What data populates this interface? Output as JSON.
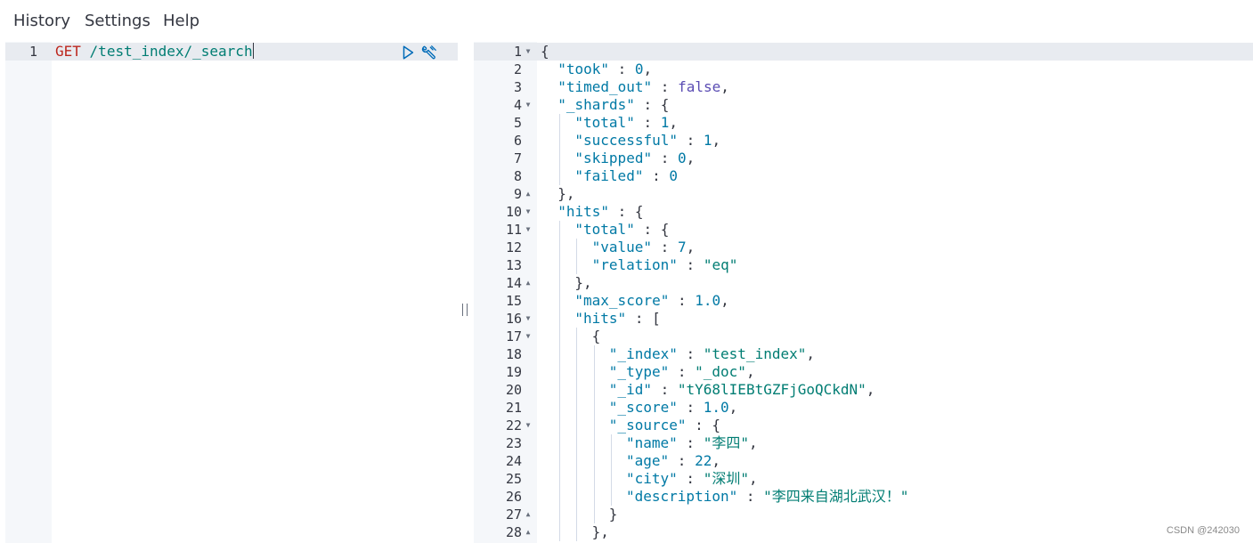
{
  "menu": {
    "history": "History",
    "settings": "Settings",
    "help": "Help"
  },
  "request": {
    "line_number": "1",
    "method": "GET",
    "path": "/test_index/_search"
  },
  "response": {
    "lines": [
      {
        "n": "1",
        "fold": "down",
        "indent": 0,
        "t": [
          [
            "p",
            "{"
          ]
        ]
      },
      {
        "n": "2",
        "indent": 1,
        "t": [
          [
            "k",
            "\"took\""
          ],
          [
            "p",
            " : "
          ],
          [
            "n",
            "0"
          ],
          [
            "p",
            ","
          ]
        ]
      },
      {
        "n": "3",
        "indent": 1,
        "t": [
          [
            "k",
            "\"timed_out\""
          ],
          [
            "p",
            " : "
          ],
          [
            "b",
            "false"
          ],
          [
            "p",
            ","
          ]
        ]
      },
      {
        "n": "4",
        "fold": "down",
        "indent": 1,
        "t": [
          [
            "k",
            "\"_shards\""
          ],
          [
            "p",
            " : {"
          ]
        ]
      },
      {
        "n": "5",
        "indent": 2,
        "t": [
          [
            "k",
            "\"total\""
          ],
          [
            "p",
            " : "
          ],
          [
            "n",
            "1"
          ],
          [
            "p",
            ","
          ]
        ]
      },
      {
        "n": "6",
        "indent": 2,
        "t": [
          [
            "k",
            "\"successful\""
          ],
          [
            "p",
            " : "
          ],
          [
            "n",
            "1"
          ],
          [
            "p",
            ","
          ]
        ]
      },
      {
        "n": "7",
        "indent": 2,
        "t": [
          [
            "k",
            "\"skipped\""
          ],
          [
            "p",
            " : "
          ],
          [
            "n",
            "0"
          ],
          [
            "p",
            ","
          ]
        ]
      },
      {
        "n": "8",
        "indent": 2,
        "t": [
          [
            "k",
            "\"failed\""
          ],
          [
            "p",
            " : "
          ],
          [
            "n",
            "0"
          ]
        ]
      },
      {
        "n": "9",
        "fold": "up",
        "indent": 1,
        "t": [
          [
            "p",
            "},"
          ]
        ]
      },
      {
        "n": "10",
        "fold": "down",
        "indent": 1,
        "t": [
          [
            "k",
            "\"hits\""
          ],
          [
            "p",
            " : {"
          ]
        ]
      },
      {
        "n": "11",
        "fold": "down",
        "indent": 2,
        "t": [
          [
            "k",
            "\"total\""
          ],
          [
            "p",
            " : {"
          ]
        ]
      },
      {
        "n": "12",
        "indent": 3,
        "t": [
          [
            "k",
            "\"value\""
          ],
          [
            "p",
            " : "
          ],
          [
            "n",
            "7"
          ],
          [
            "p",
            ","
          ]
        ]
      },
      {
        "n": "13",
        "indent": 3,
        "t": [
          [
            "k",
            "\"relation\""
          ],
          [
            "p",
            " : "
          ],
          [
            "s",
            "\"eq\""
          ]
        ]
      },
      {
        "n": "14",
        "fold": "up",
        "indent": 2,
        "t": [
          [
            "p",
            "},"
          ]
        ]
      },
      {
        "n": "15",
        "indent": 2,
        "t": [
          [
            "k",
            "\"max_score\""
          ],
          [
            "p",
            " : "
          ],
          [
            "n",
            "1.0"
          ],
          [
            "p",
            ","
          ]
        ]
      },
      {
        "n": "16",
        "fold": "down",
        "indent": 2,
        "t": [
          [
            "k",
            "\"hits\""
          ],
          [
            "p",
            " : ["
          ]
        ]
      },
      {
        "n": "17",
        "fold": "down",
        "indent": 3,
        "t": [
          [
            "p",
            "{"
          ]
        ]
      },
      {
        "n": "18",
        "indent": 4,
        "t": [
          [
            "k",
            "\"_index\""
          ],
          [
            "p",
            " : "
          ],
          [
            "s",
            "\"test_index\""
          ],
          [
            "p",
            ","
          ]
        ]
      },
      {
        "n": "19",
        "indent": 4,
        "t": [
          [
            "k",
            "\"_type\""
          ],
          [
            "p",
            " : "
          ],
          [
            "s",
            "\"_doc\""
          ],
          [
            "p",
            ","
          ]
        ]
      },
      {
        "n": "20",
        "indent": 4,
        "t": [
          [
            "k",
            "\"_id\""
          ],
          [
            "p",
            " : "
          ],
          [
            "s",
            "\"tY68lIEBtGZFjGoQCkdN\""
          ],
          [
            "p",
            ","
          ]
        ]
      },
      {
        "n": "21",
        "indent": 4,
        "t": [
          [
            "k",
            "\"_score\""
          ],
          [
            "p",
            " : "
          ],
          [
            "n",
            "1.0"
          ],
          [
            "p",
            ","
          ]
        ]
      },
      {
        "n": "22",
        "fold": "down",
        "indent": 4,
        "t": [
          [
            "k",
            "\"_source\""
          ],
          [
            "p",
            " : {"
          ]
        ]
      },
      {
        "n": "23",
        "indent": 5,
        "t": [
          [
            "k",
            "\"name\""
          ],
          [
            "p",
            " : "
          ],
          [
            "s",
            "\"李四\""
          ],
          [
            "p",
            ","
          ]
        ]
      },
      {
        "n": "24",
        "indent": 5,
        "t": [
          [
            "k",
            "\"age\""
          ],
          [
            "p",
            " : "
          ],
          [
            "n",
            "22"
          ],
          [
            "p",
            ","
          ]
        ]
      },
      {
        "n": "25",
        "indent": 5,
        "t": [
          [
            "k",
            "\"city\""
          ],
          [
            "p",
            " : "
          ],
          [
            "s",
            "\"深圳\""
          ],
          [
            "p",
            ","
          ]
        ]
      },
      {
        "n": "26",
        "indent": 5,
        "t": [
          [
            "k",
            "\"description\""
          ],
          [
            "p",
            " : "
          ],
          [
            "s",
            "\"李四来自湖北武汉！\""
          ]
        ]
      },
      {
        "n": "27",
        "fold": "up",
        "indent": 4,
        "t": [
          [
            "p",
            "}"
          ]
        ]
      },
      {
        "n": "28",
        "fold": "up",
        "indent": 3,
        "t": [
          [
            "p",
            "},"
          ]
        ]
      }
    ]
  },
  "icons": {
    "run": "play-icon",
    "settings": "wrench-icon",
    "resizer": "resize-handle-icon"
  },
  "watermark": "CSDN @242030"
}
